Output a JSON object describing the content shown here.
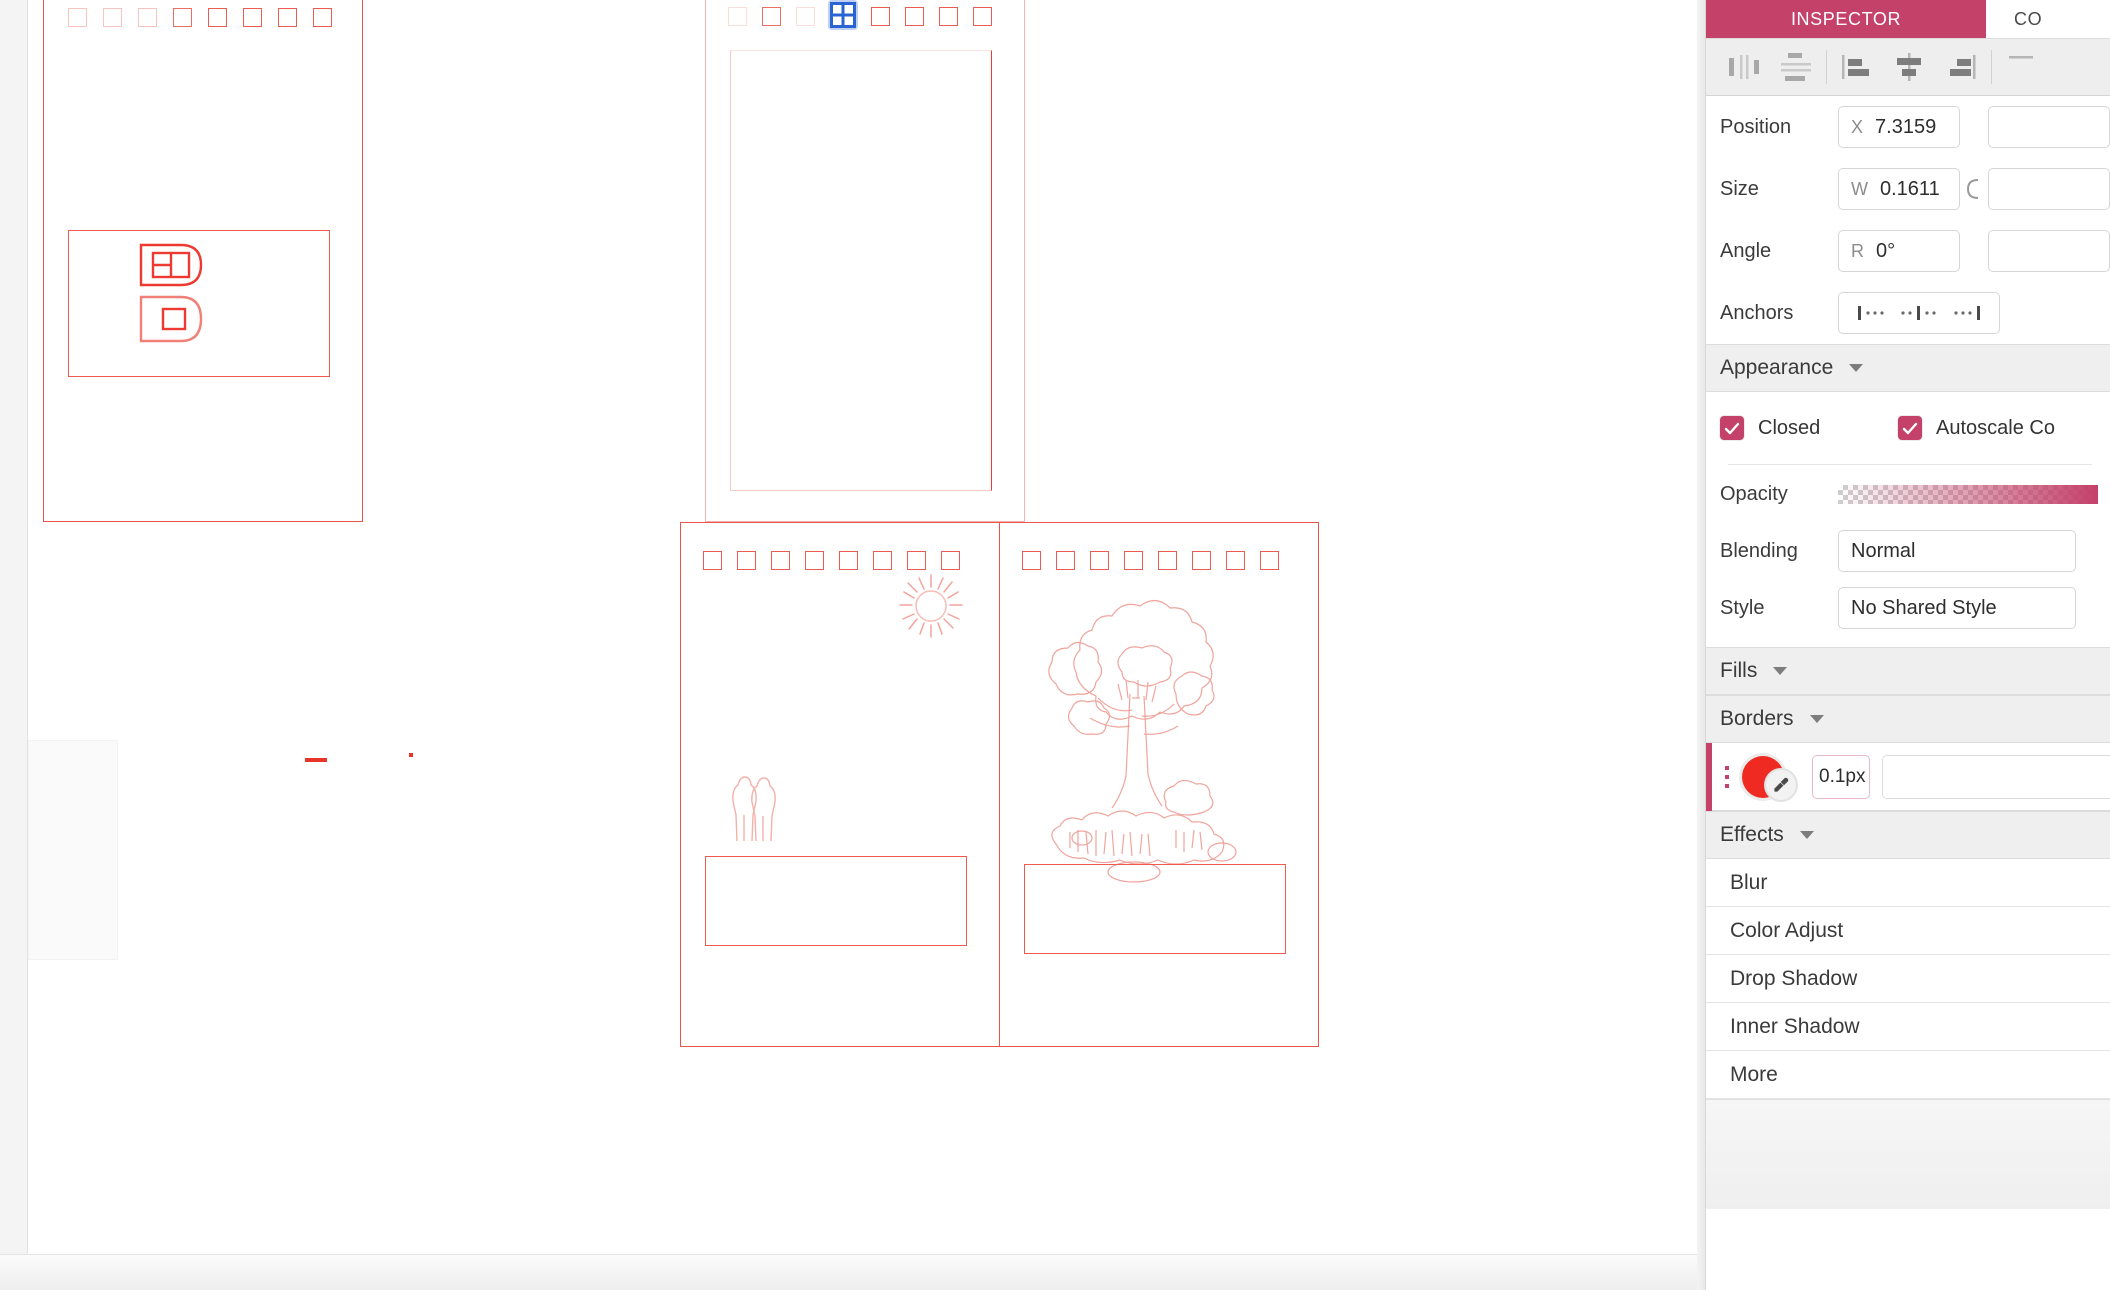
{
  "inspector": {
    "tabs": [
      {
        "label": "INSPECTOR",
        "active": true
      },
      {
        "label": "CO",
        "active": false
      }
    ],
    "align_tools": [
      {
        "name": "distribute-horizontally"
      },
      {
        "name": "distribute-vertically"
      },
      {
        "name": "align-left"
      },
      {
        "name": "align-center-horizontal"
      },
      {
        "name": "align-right"
      }
    ],
    "transform": {
      "position_label": "Position",
      "position_x_unit": "X",
      "position_x_value": "7.3159",
      "size_label": "Size",
      "size_w_unit": "W",
      "size_w_value": "0.1611",
      "angle_label": "Angle",
      "angle_r_unit": "R",
      "angle_value": "0°",
      "anchors_label": "Anchors"
    },
    "appearance": {
      "title": "Appearance",
      "closed_label": "Closed",
      "closed_checked": true,
      "autoscale_label": "Autoscale Co",
      "autoscale_checked": true,
      "opacity_label": "Opacity",
      "blending_label": "Blending",
      "blending_value": "Normal",
      "style_label": "Style",
      "style_value": "No Shared Style"
    },
    "fills": {
      "title": "Fills"
    },
    "borders": {
      "title": "Borders",
      "color_hex": "#EE2A22",
      "width_value": "0.1p",
      "width_suffix": "x"
    },
    "effects": {
      "title": "Effects",
      "items": [
        {
          "label": "Blur"
        },
        {
          "label": "Color Adjust"
        },
        {
          "label": "Drop Shadow"
        },
        {
          "label": "Inner Shadow"
        },
        {
          "label": "More"
        }
      ]
    },
    "accent_color": "#C4416A"
  },
  "canvas": {
    "stroke_color": "#EC5B50",
    "selection_color": "#2A64D2",
    "artboards": [
      {
        "name": "artboard-top-left",
        "squares": 8,
        "selected_index": -1
      },
      {
        "name": "artboard-top-middle",
        "squares": 8,
        "selected_index": 3
      },
      {
        "name": "artboard-bottom-left",
        "squares": 8,
        "selected_index": -1
      },
      {
        "name": "artboard-bottom-right",
        "squares": 8,
        "selected_index": -1
      }
    ]
  }
}
